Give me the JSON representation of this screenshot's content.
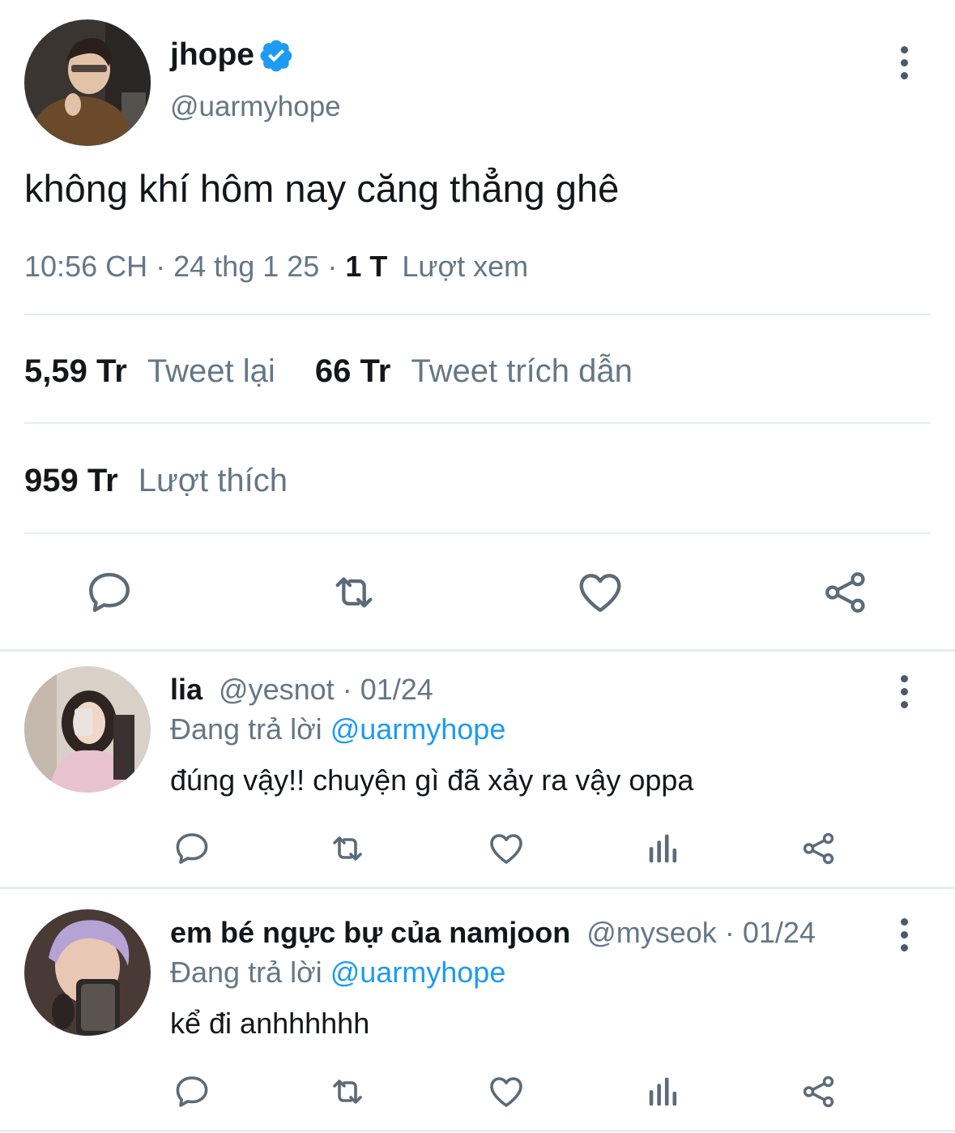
{
  "main_tweet": {
    "author_name": "jhope",
    "author_handle": "@uarmyhope",
    "verified": true,
    "text": "không khí hôm nay căng thẳng ghê",
    "time": "10:56 CH",
    "date": "24 thg 1 25",
    "views_count": "1 T",
    "views_label": "Lượt xem",
    "stats": {
      "retweets_count": "5,59 Tr",
      "retweets_label": "Tweet lại",
      "quotes_count": "66 Tr",
      "quotes_label": "Tweet trích dẫn",
      "likes_count": "959 Tr",
      "likes_label": "Lượt thích"
    },
    "actions": [
      "reply-icon",
      "retweet-icon",
      "like-icon",
      "share-icon"
    ]
  },
  "replies": [
    {
      "name": "lia",
      "handle": "@yesnot",
      "date": "01/24",
      "replying_prefix": "Đang trả lời",
      "replying_to": "@uarmyhope",
      "text": "đúng vậy!! chuyện gì đã xảy ra vậy oppa"
    },
    {
      "name": "em bé ngực bự của namjoon",
      "handle": "@myseok",
      "date": "01/24",
      "replying_prefix": "Đang trả lời",
      "replying_to": "@uarmyhope",
      "text": "kể đi anhhhhhh"
    }
  ],
  "separator": "·",
  "colors": {
    "link": "#1d9bf0",
    "verified": "#1d9bf0",
    "muted": "#657786",
    "icon": "#5b6b78"
  }
}
